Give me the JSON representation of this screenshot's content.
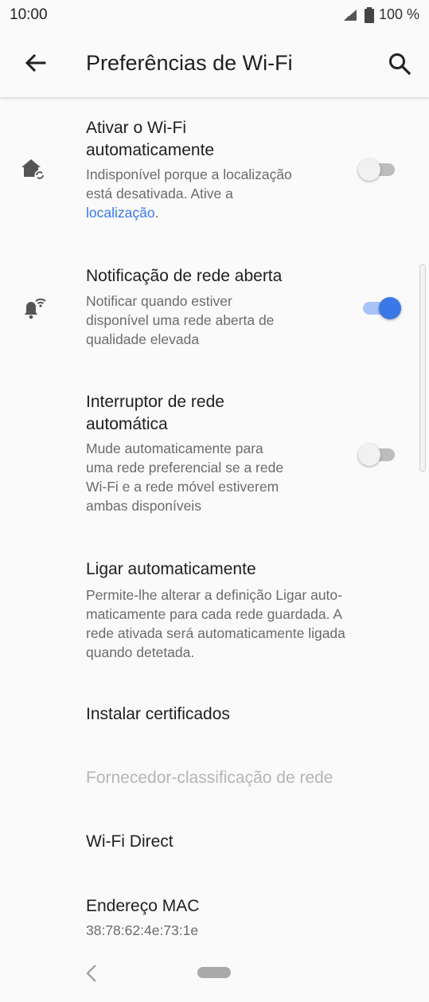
{
  "status_bar": {
    "time": "10:00",
    "battery": "100 %"
  },
  "app_bar": {
    "title": "Preferências de Wi-Fi"
  },
  "items": [
    {
      "title_line1": "Ativar o Wi-Fi",
      "title_line2": "automaticamente",
      "sub_line1": "Indisponível porque a localização",
      "sub_line2": "está desativada. Ative a",
      "sub_link": "localização",
      "sub_after_link": ".",
      "icon": "home-sync-icon",
      "switch_on": false
    },
    {
      "title_line1": "Notificação de rede aberta",
      "sub_line1": "Notificar quando estiver",
      "sub_line2": "disponível uma rede aberta de",
      "sub_line3": "qualidade elevada",
      "icon": "bell-wifi-icon",
      "switch_on": true
    },
    {
      "title_line1": "Interruptor de rede",
      "title_line2": "automática",
      "sub_line1": "Mude automaticamente para",
      "sub_line2": "uma rede preferencial se a rede",
      "sub_line3": "Wi-Fi e a rede móvel estiverem",
      "sub_line4": "ambas disponíveis",
      "switch_on": false
    },
    {
      "title_line1": "Ligar automaticamente",
      "sub_line1": "Permite-lhe alterar a definição Ligar auto-",
      "sub_line2": "maticamente para cada rede guardada. A",
      "sub_line3": "rede ativada será automaticamente ligada",
      "sub_line4": "quando detetada."
    },
    {
      "title_line1": "Instalar certificados"
    },
    {
      "title_line1": "Fornecedor-classificação de rede",
      "disabled": true
    },
    {
      "title_line1": "Wi-Fi Direct"
    },
    {
      "title_line1": "Endereço MAC",
      "sub_line1": "38:78:62:4e:73:1e"
    }
  ],
  "colors": {
    "accent": "#3b78e7",
    "text_primary": "#202020",
    "text_secondary": "#6b6b6b",
    "disabled": "#b5b5b5",
    "background": "#fafafa"
  }
}
